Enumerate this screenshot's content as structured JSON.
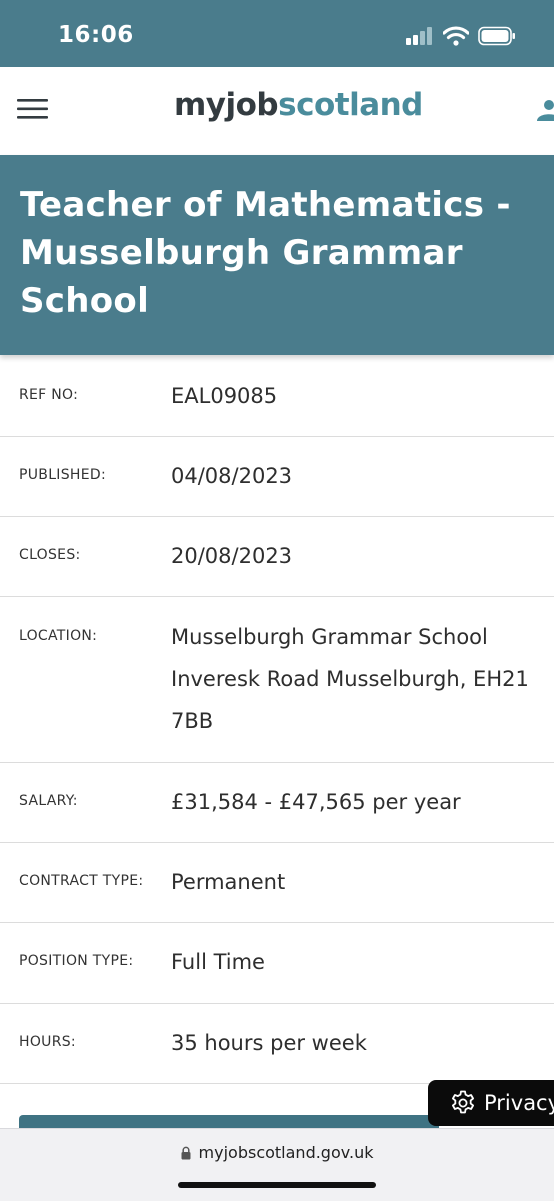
{
  "status_bar": {
    "time": "16:06"
  },
  "header": {
    "logo_part1": "myjob",
    "logo_part2": "scotland"
  },
  "job": {
    "title": "Teacher of Mathematics - Musselburgh Grammar School"
  },
  "details": [
    {
      "label": "REF NO:",
      "value": "EAL09085"
    },
    {
      "label": "PUBLISHED:",
      "value": "04/08/2023"
    },
    {
      "label": "CLOSES:",
      "value": "20/08/2023"
    },
    {
      "label": "LOCATION:",
      "value": "Musselburgh Grammar School Inveresk Road Musselburgh, EH21 7BB"
    },
    {
      "label": "SALARY:",
      "value": "£31,584 - £47,565 per year"
    },
    {
      "label": "CONTRACT TYPE:",
      "value": "Permanent"
    },
    {
      "label": "POSITION TYPE:",
      "value": "Full Time"
    },
    {
      "label": "HOURS:",
      "value": "35 hours per week"
    }
  ],
  "privacy": {
    "label": "Privacy"
  },
  "browser": {
    "url": "myjobscotland.gov.uk"
  },
  "icons": [
    "signal-icon",
    "wifi-icon",
    "battery-icon",
    "menu-icon",
    "user-icon",
    "gear-icon",
    "lock-icon"
  ],
  "colors": {
    "brand_teal": "#4a7c8c",
    "logo_dark": "#333b40",
    "logo_teal": "#4a8c9c"
  }
}
